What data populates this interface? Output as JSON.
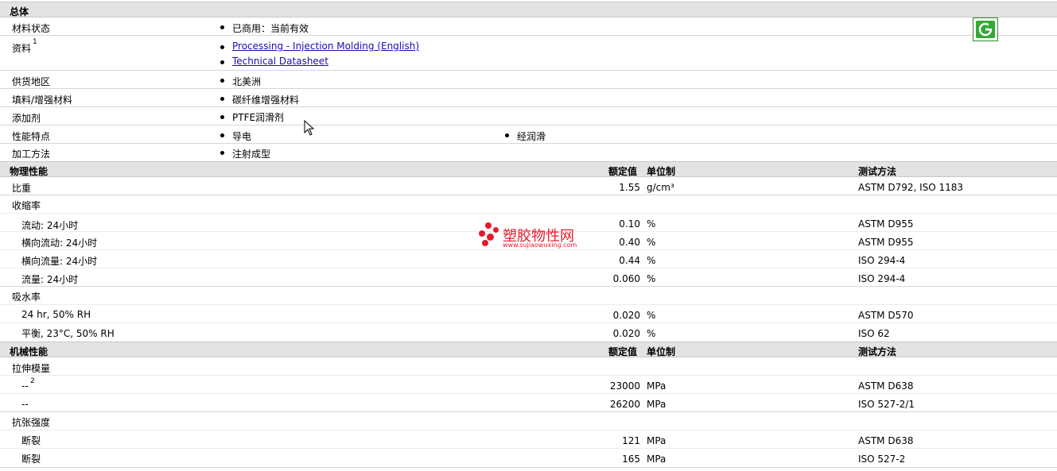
{
  "general": {
    "title": "总体",
    "material_status_label": "材料状态",
    "material_status_value": "已商用：当前有效",
    "docs_label": "资料",
    "docs_sup": "1",
    "doc_link_1": "Processing - Injection Molding (English)",
    "doc_link_2": "Technical Datasheet",
    "region_label": "供货地区",
    "region_value": "北美洲",
    "filler_label": "填料/增强材料",
    "filler_value": "碳纤维增强材料",
    "additive_label": "添加剂",
    "additive_value": "PTFE润滑剂",
    "features_label": "性能特点",
    "feature_1": "导电",
    "feature_2": "经润滑",
    "process_label": "加工方法",
    "process_value": "注射成型"
  },
  "physical": {
    "title": "物理性能",
    "col_value": "额定值",
    "col_unit": "单位制",
    "col_method": "测试方法",
    "rows": [
      {
        "label": "比重",
        "value": "1.55",
        "unit": "g/cm³",
        "method": "ASTM D792, ISO 1183"
      },
      {
        "label": "收缩率"
      },
      {
        "label": "流动: 24小时",
        "value": "0.10",
        "unit": "%",
        "method": "ASTM D955"
      },
      {
        "label": "横向流动: 24小时",
        "value": "0.40",
        "unit": "%",
        "method": "ASTM D955"
      },
      {
        "label": "横向流量: 24小时",
        "value": "0.44",
        "unit": "%",
        "method": "ISO 294-4"
      },
      {
        "label": "流量: 24小时",
        "value": "0.060",
        "unit": "%",
        "method": "ISO 294-4"
      },
      {
        "label": "吸水率"
      },
      {
        "label": "24 hr, 50% RH",
        "value": "0.020",
        "unit": "%",
        "method": "ASTM D570"
      },
      {
        "label": "平衡, 23°C, 50% RH",
        "value": "0.020",
        "unit": "%",
        "method": "ISO 62"
      }
    ]
  },
  "mechanical": {
    "title": "机械性能",
    "col_value": "额定值",
    "col_unit": "单位制",
    "col_method": "测试方法",
    "rows": [
      {
        "label": "拉伸模量"
      },
      {
        "label": "--",
        "sup": "2",
        "value": "23000",
        "unit": "MPa",
        "method": "ASTM D638"
      },
      {
        "label": "--",
        "value": "26200",
        "unit": "MPa",
        "method": "ISO 527-2/1"
      },
      {
        "label": "抗张强度"
      },
      {
        "label": "断裂",
        "value": "121",
        "unit": "MPa",
        "method": "ASTM D638"
      },
      {
        "label": "断裂",
        "value": "165",
        "unit": "MPa",
        "method": "ISO 527-2"
      }
    ]
  },
  "watermark": {
    "title": "塑胶物性网",
    "url": "www.sujiaowuxing.com",
    "color": "#e8182a"
  },
  "icons": {
    "badge": "g-logo-icon",
    "pointer": "mouse-cursor-icon"
  }
}
